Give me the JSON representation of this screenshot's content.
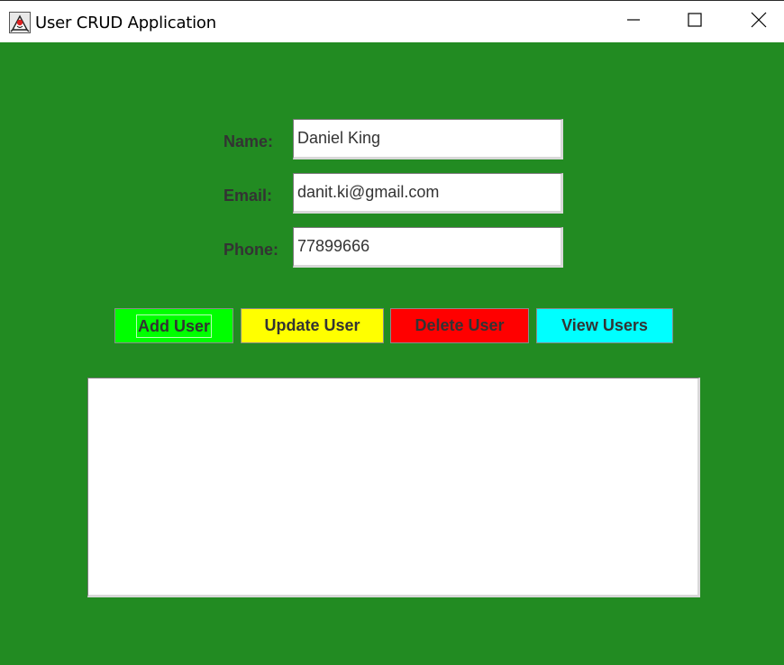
{
  "window": {
    "title": "User CRUD Application",
    "icon": "java-duke-icon",
    "controls": [
      "minimize-icon",
      "maximize-icon",
      "close-icon"
    ]
  },
  "colors": {
    "background": "#228b22",
    "add_button": "#00ff00",
    "update_button": "#ffff00",
    "delete_button": "#ff0000",
    "view_button": "#00ffff",
    "label_text": "#333333"
  },
  "form": {
    "name_label": "Name:",
    "name_value": "Daniel King",
    "email_label": "Email:",
    "email_value": "danit.ki@gmail.com",
    "phone_label": "Phone:",
    "phone_value": "77899666"
  },
  "buttons": {
    "add": "Add User",
    "update": "Update User",
    "delete": "Delete User",
    "view": "View Users"
  },
  "output": {
    "text": ""
  }
}
